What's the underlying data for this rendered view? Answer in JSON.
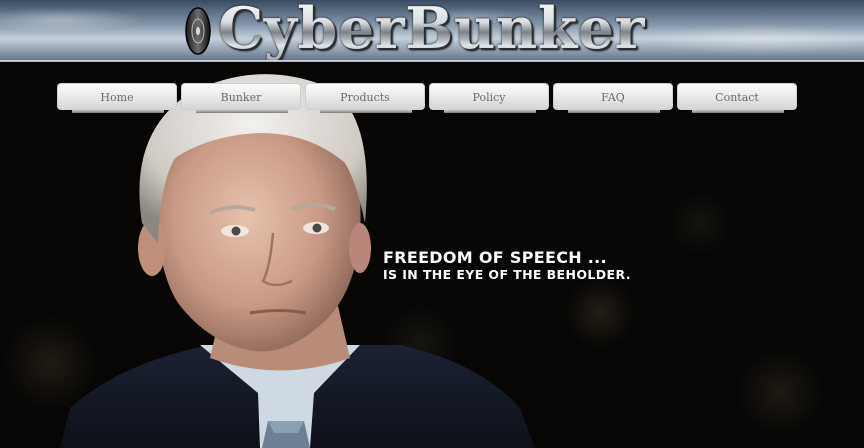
{
  "site": {
    "logo_text": "CyberBunker",
    "logo_icon": "disc-icon"
  },
  "nav": {
    "items": [
      {
        "label": "Home"
      },
      {
        "label": "Bunker"
      },
      {
        "label": "Products"
      },
      {
        "label": "Policy"
      },
      {
        "label": "FAQ"
      },
      {
        "label": "Contact"
      }
    ]
  },
  "hero": {
    "headline": "FREEDOM OF SPEECH ...",
    "subline": "IS IN THE EYE OF THE BEHOLDER."
  },
  "colors": {
    "background": "#060504",
    "nav_button": "#e8e8e8",
    "nav_text": "#6b6b6b",
    "tagline": "#ffffff"
  }
}
